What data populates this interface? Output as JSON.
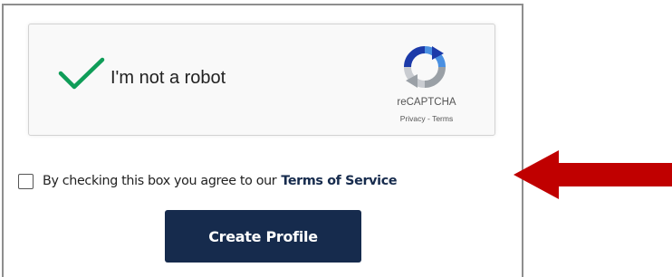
{
  "recaptcha": {
    "label": "I'm not a robot",
    "checked": true,
    "brand": "reCAPTCHA",
    "links": "Privacy - Terms",
    "check_icon": "checkmark-icon",
    "logo_icon": "recaptcha-logo-icon"
  },
  "terms": {
    "checked": false,
    "text": "By checking this box you agree to our",
    "link_label": "Terms of Service"
  },
  "actions": {
    "create_label": "Create Profile"
  },
  "annotation": {
    "arrow_icon": "left-arrow-icon",
    "color": "#c00000"
  },
  "colors": {
    "button_bg": "#162b4d",
    "check_green": "#0f9d58",
    "link": "#162b4d"
  }
}
